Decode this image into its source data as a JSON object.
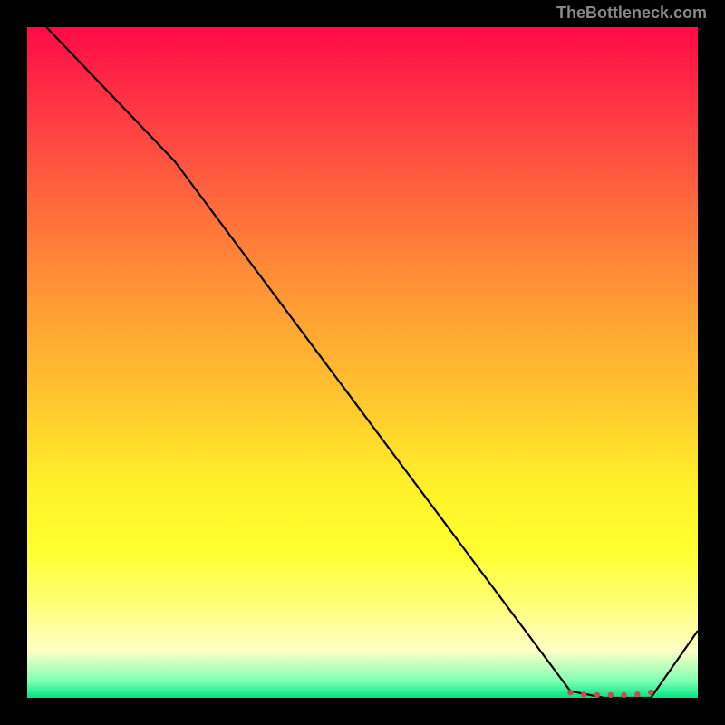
{
  "watermark": "TheBottleneck.com",
  "chart_data": {
    "type": "line",
    "title": "",
    "xlabel": "",
    "ylabel": "",
    "xlim": [
      0,
      100
    ],
    "ylim": [
      0,
      100
    ],
    "x": [
      0,
      22,
      81,
      86,
      93,
      100
    ],
    "values": [
      103,
      80,
      1,
      0,
      0,
      10
    ],
    "markers": {
      "x": [
        81,
        83,
        85,
        87,
        89,
        91,
        93
      ],
      "y": [
        0.8,
        0.5,
        0.4,
        0.4,
        0.4,
        0.5,
        0.8
      ],
      "color": "#c94b4b"
    },
    "background": "vertical-gradient red-to-green",
    "line_color": "#000000"
  }
}
